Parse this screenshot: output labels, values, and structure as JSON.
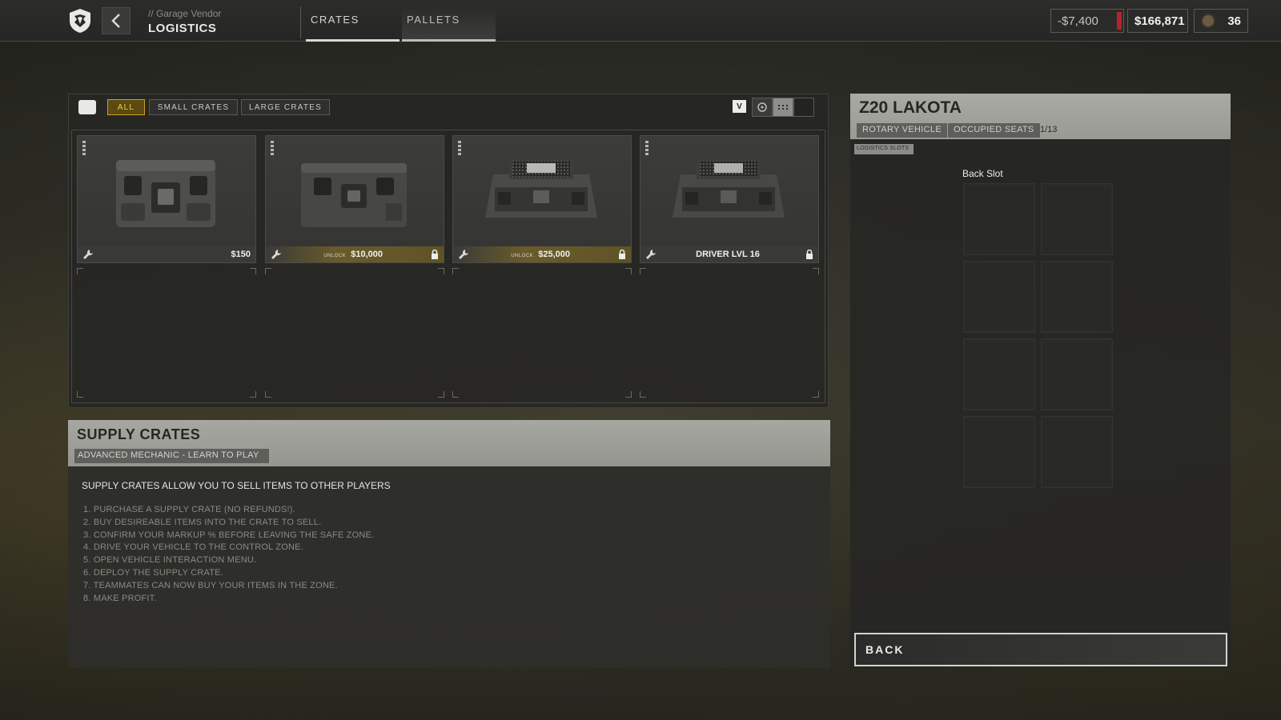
{
  "header": {
    "breadcrumb": "// Garage Vendor",
    "title": "LOGISTICS",
    "tabs": [
      {
        "label": "CRATES",
        "active": true
      },
      {
        "label": "PALLETS",
        "active": false
      }
    ]
  },
  "wallet": {
    "debt": "-$7,400",
    "balance": "$166,871",
    "level": "36"
  },
  "filters": {
    "items": [
      {
        "label": "ALL",
        "selected": true
      },
      {
        "label": "SMALL CRATES",
        "selected": false
      },
      {
        "label": "LARGE CRATES",
        "selected": false
      }
    ],
    "view_key": "V"
  },
  "crates": [
    {
      "price": "$150",
      "unlock_label": "",
      "locked": false,
      "requirement": ""
    },
    {
      "price": "$10,000",
      "unlock_label": "UNLOCK",
      "locked": true,
      "requirement": ""
    },
    {
      "price": "$25,000",
      "unlock_label": "UNLOCK",
      "locked": true,
      "requirement": ""
    },
    {
      "price": "",
      "unlock_label": "",
      "locked": true,
      "requirement": "DRIVER LVL 16"
    }
  ],
  "info": {
    "title": "SUPPLY CRATES",
    "subtag": "ADVANCED MECHANIC - LEARN TO PLAY",
    "lead": "SUPPLY CRATES ALLOW YOU TO SELL ITEMS TO OTHER PLAYERS",
    "steps": [
      "1. PURCHASE A SUPPLY CRATE (NO REFUNDS!).",
      "2. BUY DESIREABLE ITEMS INTO THE CRATE TO SELL.",
      "3. CONFIRM YOUR MARKUP % BEFORE LEAVING THE SAFE ZONE.",
      "4. DRIVE YOUR VEHICLE TO THE CONTROL ZONE.",
      "5. OPEN VEHICLE INTERACTION MENU.",
      "6. DEPLOY THE SUPPLY CRATE.",
      "7. TEAMMATES CAN NOW BUY YOUR ITEMS IN THE ZONE.",
      "8. MAKE PROFIT."
    ]
  },
  "vehicle": {
    "name": "Z20 LAKOTA",
    "type": "ROTARY VEHICLE",
    "seats_label": "OCCUPIED SEATS",
    "seats_value": "1/13",
    "logistics_label": "LOGISTICS SLOTS",
    "slot_label": "Back Slot",
    "back_button": "BACK"
  },
  "colors": {
    "accent_gold": "#f2cf46",
    "debt_marker": "#b8232a"
  }
}
